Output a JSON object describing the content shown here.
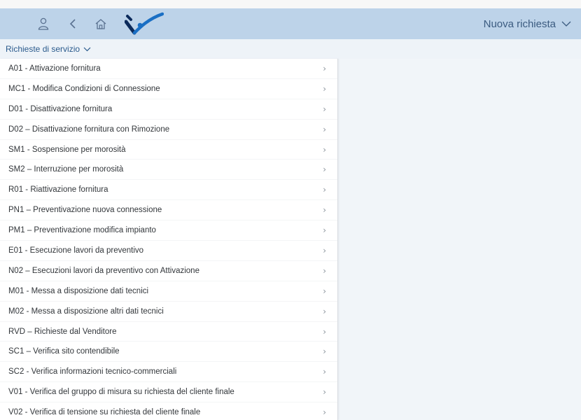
{
  "header": {
    "user_icon": "user-icon",
    "back_icon": "back-icon",
    "home_icon": "home-icon",
    "logo": "brand-logo",
    "action_label": "Nuova richiesta"
  },
  "subheader": {
    "selector_label": "Richieste di servizio"
  },
  "list": {
    "items": [
      "A01 - Attivazione fornitura",
      "MC1 - Modifica Condizioni di Connessione",
      "D01 - Disattivazione fornitura",
      "D02 – Disattivazione fornitura con Rimozione",
      "SM1 - Sospensione per morosità",
      "SM2 – Interruzione per morosità",
      "R01 - Riattivazione fornitura",
      "PN1 – Preventivazione nuova connessione",
      "PM1 – Preventivazione modifica impianto",
      "E01 - Esecuzione lavori da preventivo",
      "N02 – Esecuzioni lavori da preventivo con Attivazione",
      "M01 - Messa a disposizione dati tecnici",
      "M02 - Messa a disposizione altri dati tecnici",
      "RVD – Richieste dal Venditore",
      "SC1 – Verifica sito contendibile",
      "SC2 - Verifica informazioni tecnico-commerciali",
      "V01 - Verifica del gruppo di misura su richiesta del cliente finale",
      "V02 - Verifica di tensione su richiesta del cliente finale"
    ]
  },
  "colors": {
    "shellbar": "#bdd3e9",
    "accent": "#3b5b80",
    "logo_blue": "#1a6fc4",
    "logo_dark": "#0b2a5b"
  }
}
